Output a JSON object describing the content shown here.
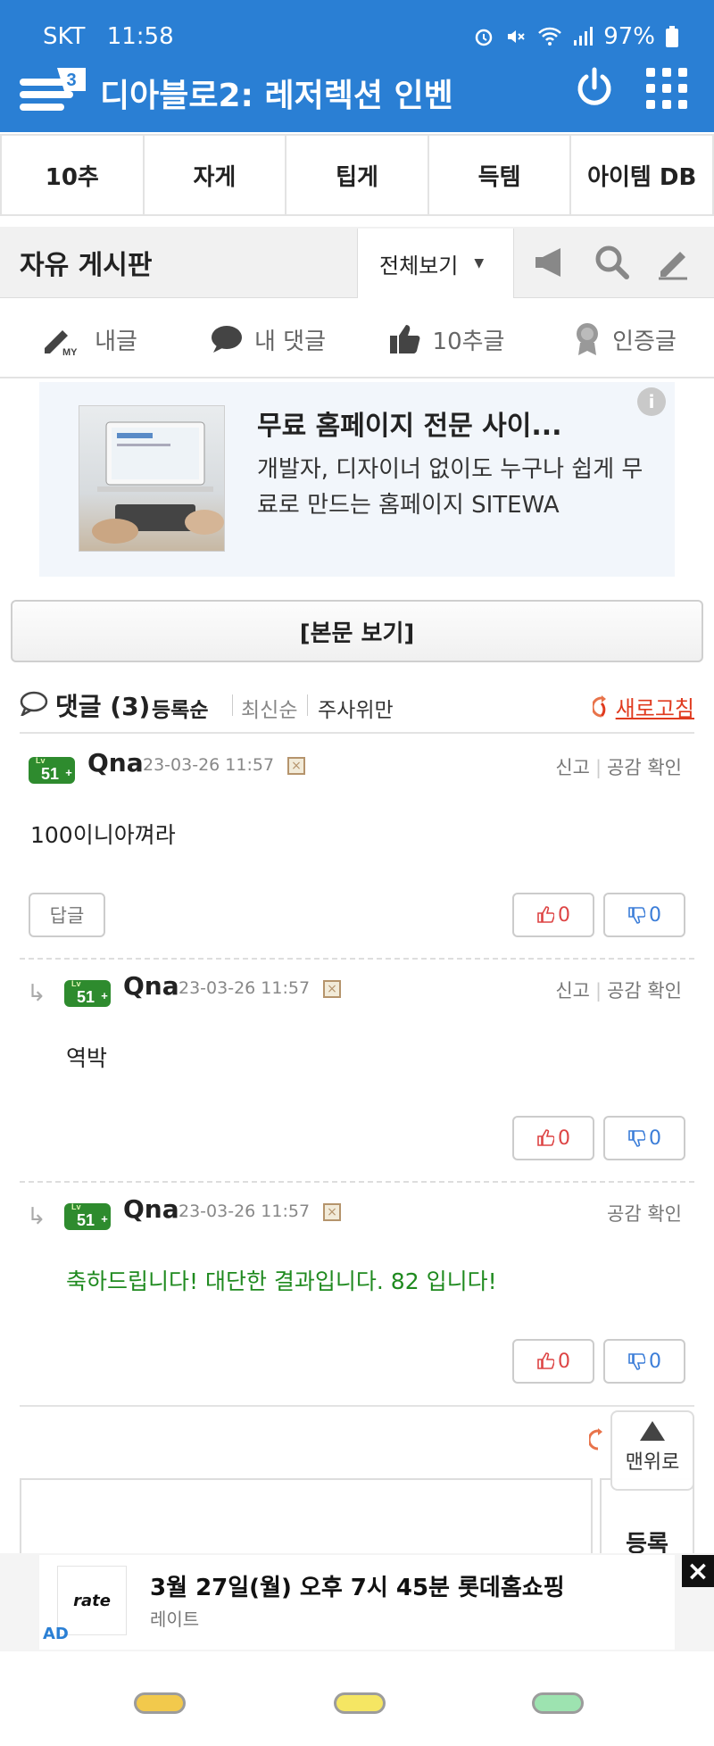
{
  "status_bar": {
    "carrier": "SKT",
    "time": "11:58",
    "battery": "97%",
    "icons": [
      "alarm-icon",
      "mute-icon",
      "wifi-icon",
      "signal-icon",
      "battery-icon"
    ]
  },
  "header": {
    "logo_icon": "inven-logo-icon",
    "title": "디아블로2: 레저렉션 인벤",
    "power_icon": "power-icon",
    "menu_icon": "grid-menu-icon",
    "bg_color": "#2a7fd4"
  },
  "category_tabs": [
    {
      "label": "10추"
    },
    {
      "label": "자게"
    },
    {
      "label": "팁게"
    },
    {
      "label": "득템"
    },
    {
      "label": "아이템 DB"
    }
  ],
  "board": {
    "title": "자유 게시판",
    "view_select": "전체보기",
    "icons": [
      "megaphone-icon",
      "search-icon",
      "pencil-icon"
    ]
  },
  "my_bar": [
    {
      "icon": "my-pencil-icon",
      "label": "내글"
    },
    {
      "icon": "comment-icon",
      "label": "내 댓글"
    },
    {
      "icon": "thumbs-up-icon",
      "label": "10추글"
    },
    {
      "icon": "badge-icon",
      "label": "인증글"
    }
  ],
  "ad_card": {
    "title": "무료 홈페이지 전문 사이...",
    "description": "개발자, 디자이너 없이도 누구나 쉽게 무료로 만드는 홈페이지 SITEWA",
    "info_icon": "info-icon"
  },
  "view_body_button": "[본문 보기]",
  "comments_header": {
    "label": "댓글",
    "count": "(3)",
    "sort_options": [
      "등록순",
      "최신순",
      "주사위만"
    ],
    "active_sort": "등록순",
    "refresh": "새로고침"
  },
  "comments": [
    {
      "level": "51",
      "name": "Qna",
      "date": "23-03-26 11:57",
      "actions": [
        "신고",
        "공감 확인"
      ],
      "text": "100이니아껴라",
      "reply_label": "답글",
      "upvotes": "0",
      "downvotes": "0",
      "is_reply": false
    },
    {
      "level": "51",
      "name": "Qna",
      "date": "23-03-26 11:57",
      "actions": [
        "신고",
        "공감 확인"
      ],
      "text": "역박",
      "upvotes": "0",
      "downvotes": "0",
      "is_reply": true
    },
    {
      "level": "51",
      "name": "Qna",
      "date": "23-03-26 11:57",
      "actions": [
        "공감 확인"
      ],
      "text": "축하드립니다! 대단한 결과입니다. 82 입니다!",
      "upvotes": "0",
      "downvotes": "0",
      "is_reply": true
    }
  ],
  "composer": {
    "submit": "등록",
    "to_top": "맨위로"
  },
  "bottom_ad": {
    "logo_text": "rate",
    "main": "3월 27일(월) 오후 7시 45분 롯데홈쇼핑",
    "sub": "레이트",
    "tag": "AD",
    "close_icon": "close-icon"
  },
  "nav_buttons": [
    "recent-apps-button",
    "home-button",
    "back-button"
  ]
}
